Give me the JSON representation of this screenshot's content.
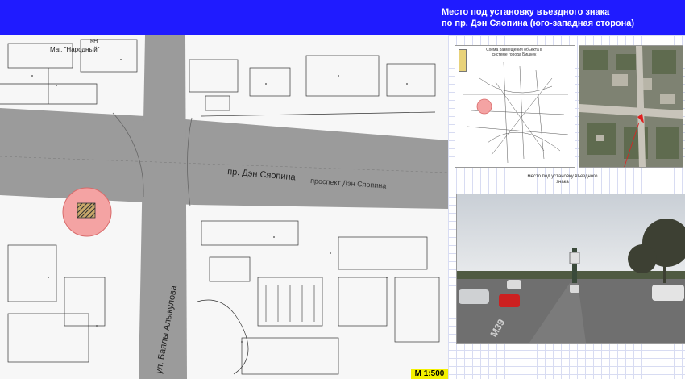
{
  "header": {
    "title_line1": "Место под установку въездного знака",
    "title_line2": "по пр. Дэн Сяопина (юго-западная сторона)"
  },
  "map": {
    "street_label_1": "пр. Дэн Сяопина",
    "street_label_2": "проспект  Дэн  Сяопина",
    "street_label_3": "ул. Баялы Алыкулова",
    "shop_label": "Маг. \"Народный\"",
    "kn_label": "КН",
    "scale_label": "М 1:500"
  },
  "city_scheme": {
    "title": "Схема размещения объекта в системе города Бишкек"
  },
  "aerial": {
    "caption": "место под установку въездного знака"
  },
  "street_photo": {
    "road_marking": "М39"
  },
  "colors": {
    "header_bg": "#1f1bff",
    "road_gray": "#9b9b9b",
    "marker_pink": "#f4a3a3",
    "marker_border": "#d86a6a",
    "scale_yellow": "#f3f000",
    "pointer_red": "#e02020"
  }
}
